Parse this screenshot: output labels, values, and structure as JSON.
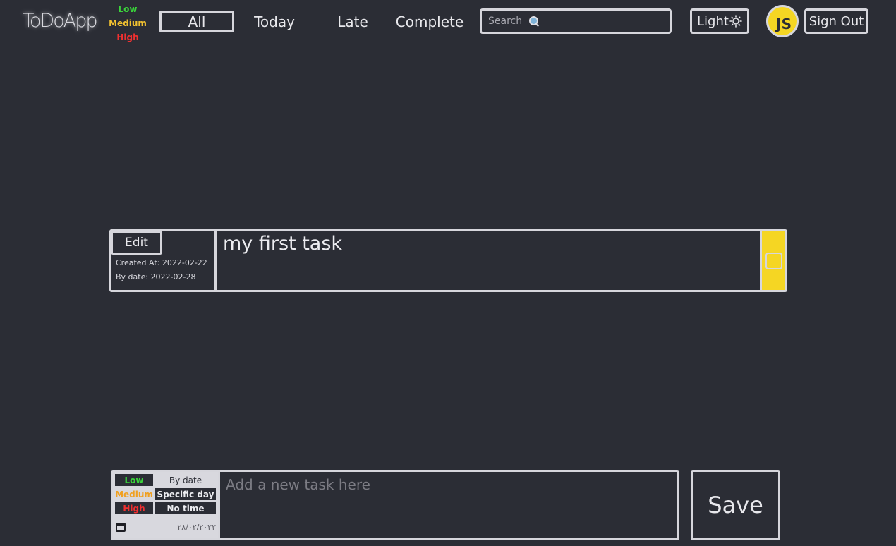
{
  "header": {
    "logo": "ToDoApp",
    "priority_legend": {
      "low": "Low",
      "medium": "Medium",
      "high": "High"
    },
    "nav": {
      "all": "All",
      "today": "Today",
      "late": "Late",
      "complete": "Complete"
    },
    "search": {
      "placeholder": "Search",
      "icon": "search-icon"
    },
    "theme_button": {
      "label": "Light",
      "icon": "sun-icon"
    },
    "avatar": {
      "initials": "JS",
      "color": "#f5d623"
    },
    "sign_out": "Sign Out"
  },
  "tasks": [
    {
      "edit_label": "Edit",
      "created_at": "Created At: 2022-02-22",
      "by_date": "By date: 2022-02-28",
      "text": "my first task",
      "priority_color": "#f5d623",
      "completed": false
    }
  ],
  "new_task": {
    "priority": {
      "low": "Low",
      "medium": "Medium",
      "high": "High"
    },
    "date_modes": {
      "by_date": "By date",
      "specific_day": "Specific day",
      "no_time": "No time"
    },
    "date_value": "٢٨/٠٢/٢٠٢٢",
    "placeholder": "Add a new task here",
    "save_label": "Save"
  },
  "colors": {
    "background": "#2b2d35",
    "border": "#d6d6dc",
    "low": "#3ad43a",
    "medium": "#f0c030",
    "high": "#f03030"
  }
}
